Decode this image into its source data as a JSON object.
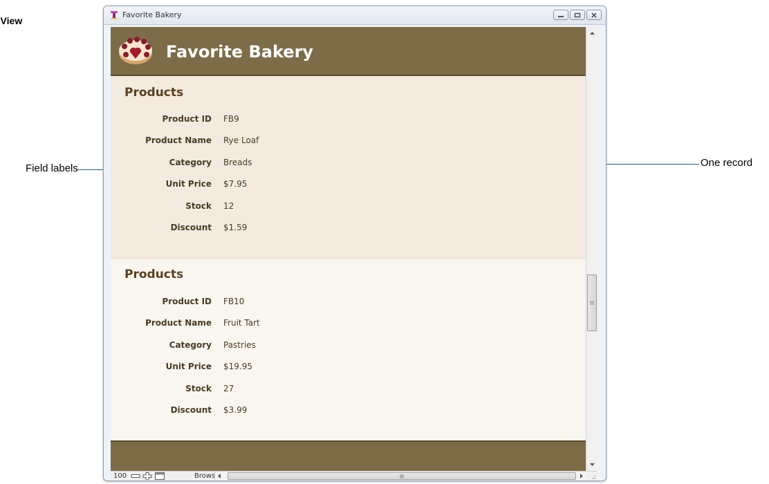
{
  "page": {
    "heading": "t View"
  },
  "callouts": {
    "left_label": "Field labels",
    "right_label": "One record"
  },
  "window": {
    "title": "Favorite Bakery"
  },
  "header": {
    "title": "Favorite Bakery"
  },
  "records": [
    {
      "section_title": "Products",
      "fields": [
        {
          "label": "Product ID",
          "value": "FB9"
        },
        {
          "label": "Product Name",
          "value": "Rye Loaf"
        },
        {
          "label": "Category",
          "value": "Breads"
        },
        {
          "label": "Unit Price",
          "value": "$7.95"
        },
        {
          "label": "Stock",
          "value": "12"
        },
        {
          "label": "Discount",
          "value": "$1.59"
        }
      ]
    },
    {
      "section_title": "Products",
      "fields": [
        {
          "label": "Product ID",
          "value": "FB10"
        },
        {
          "label": "Product Name",
          "value": "Fruit Tart"
        },
        {
          "label": "Category",
          "value": "Pastries"
        },
        {
          "label": "Unit Price",
          "value": "$19.95"
        },
        {
          "label": "Stock",
          "value": "27"
        },
        {
          "label": "Discount",
          "value": "$3.99"
        }
      ]
    }
  ],
  "statusbar": {
    "zoom": "100",
    "mode": "Browse"
  },
  "colors": {
    "header_band": "#7c6c48",
    "record_title": "#5a3f1e",
    "callout_line": "#1b5a8c"
  }
}
